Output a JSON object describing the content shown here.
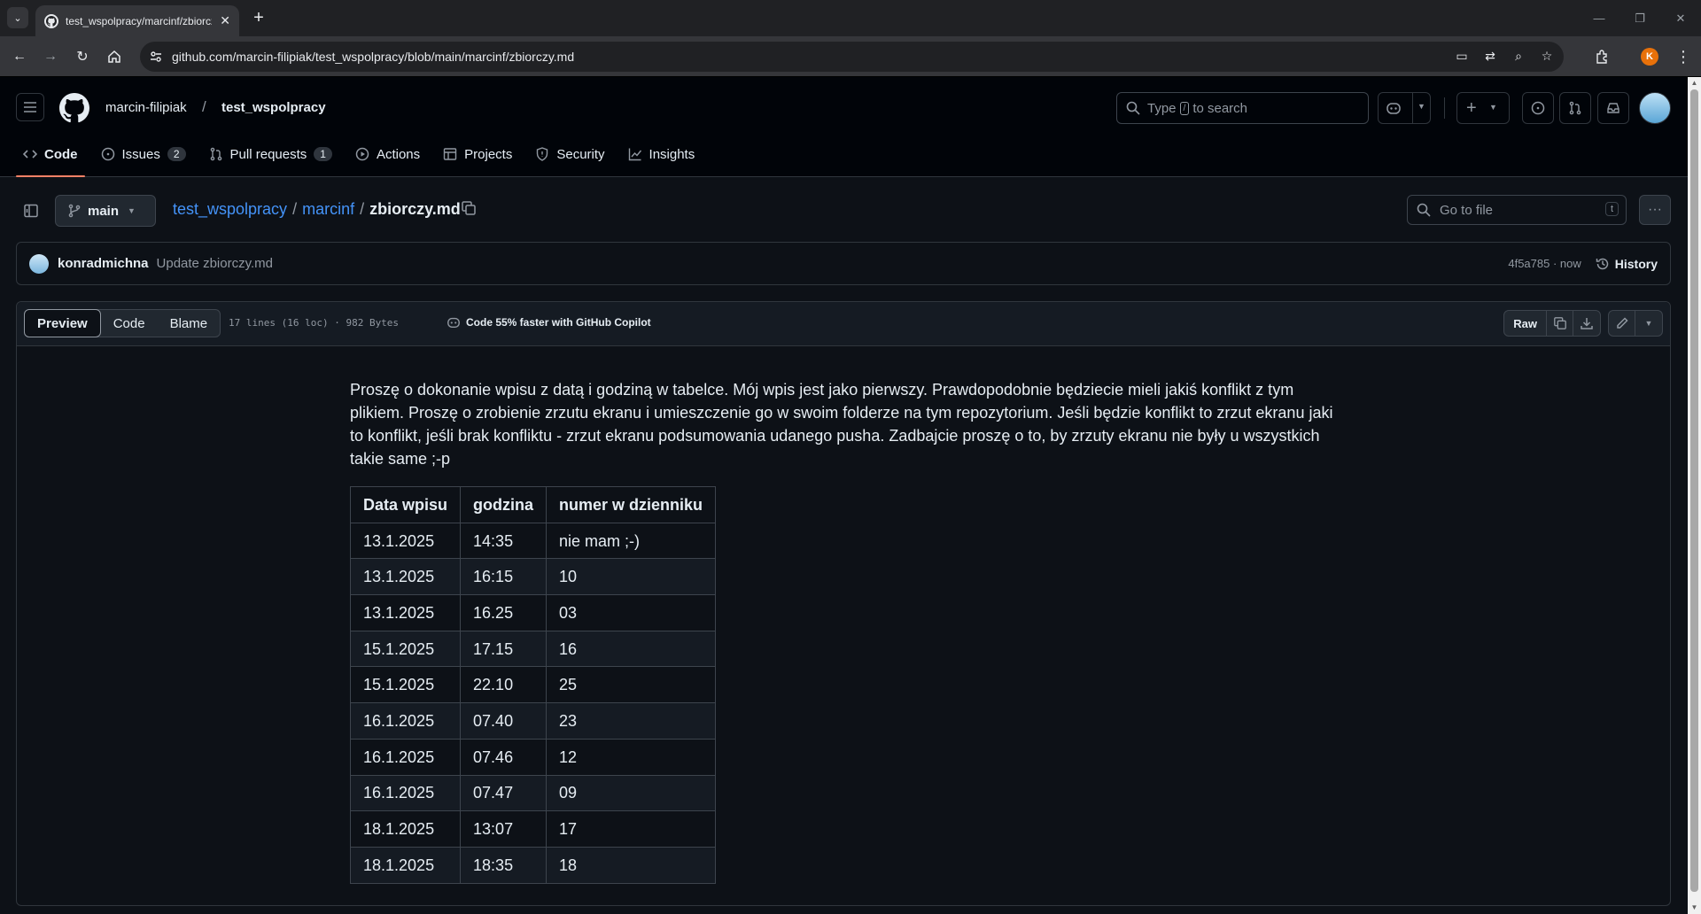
{
  "browser": {
    "tab_title": "test_wspolpracy/marcinf/zbiorczy.md",
    "url": "github.com/marcin-filipiak/test_wspolpracy/blob/main/marcinf/zbiorczy.md",
    "profile_initial": "K"
  },
  "header": {
    "owner": "marcin-filipiak",
    "separator": "/",
    "repo": "test_wspolpracy",
    "search_prefix": "Type",
    "search_key": "/",
    "search_suffix": "to search"
  },
  "repo_nav": [
    {
      "label": "Code",
      "icon": "code-icon",
      "active": true
    },
    {
      "label": "Issues",
      "icon": "issue-icon",
      "count": "2"
    },
    {
      "label": "Pull requests",
      "icon": "pull-request-icon",
      "count": "1"
    },
    {
      "label": "Actions",
      "icon": "play-icon"
    },
    {
      "label": "Projects",
      "icon": "table-icon"
    },
    {
      "label": "Security",
      "icon": "shield-icon"
    },
    {
      "label": "Insights",
      "icon": "graph-icon"
    }
  ],
  "file_header": {
    "branch": "main",
    "path": [
      {
        "label": "test_wspolpracy"
      },
      {
        "label": "marcinf"
      }
    ],
    "path_sep": "/",
    "file_name": "zbiorczy.md",
    "goto_placeholder": "Go to file",
    "goto_key": "t"
  },
  "commit": {
    "author": "konradmichna",
    "message": "Update zbiorczy.md",
    "meta": "4f5a785 · now",
    "history_label": "History"
  },
  "file_toolbar": {
    "tabs": [
      "Preview",
      "Code",
      "Blame"
    ],
    "stats": "17 lines (16 loc) · 982 Bytes",
    "copilot": "Code 55% faster with GitHub Copilot",
    "raw_label": "Raw"
  },
  "content": {
    "paragraph": "Proszę o dokonanie wpisu z datą i godziną w tabelce. Mój wpis jest jako pierwszy. Prawdopodobnie będziecie mieli jakiś konflikt z tym plikiem. Proszę o zrobienie zrzutu ekranu i umieszczenie go w swoim folderze na tym repozytorium. Jeśli będzie konflikt to zrzut ekranu jaki to konflikt, jeśli brak konfliktu - zrzut ekranu podsumowania udanego pusha. Zadbajcie proszę o to, by zrzuty ekranu nie były u wszystkich takie same ;-p",
    "table": {
      "headers": [
        "Data wpisu",
        "godzina",
        "numer w dzienniku"
      ],
      "rows": [
        [
          "13.1.2025",
          "14:35",
          "nie mam ;-)"
        ],
        [
          "13.1.2025",
          "16:15",
          "10"
        ],
        [
          "13.1.2025",
          "16.25",
          "03"
        ],
        [
          "15.1.2025",
          "17.15",
          "16"
        ],
        [
          "15.1.2025",
          "22.10",
          "25"
        ],
        [
          "16.1.2025",
          "07.40",
          "23"
        ],
        [
          "16.1.2025",
          "07.46",
          "12"
        ],
        [
          "16.1.2025",
          "07.47",
          "09"
        ],
        [
          "18.1.2025",
          "13:07",
          "17"
        ],
        [
          "18.1.2025",
          "18:35",
          "18"
        ]
      ]
    }
  },
  "colors": {
    "accent_link": "#4493f8",
    "nav_underline": "#f78166",
    "background": "#0d1117"
  }
}
